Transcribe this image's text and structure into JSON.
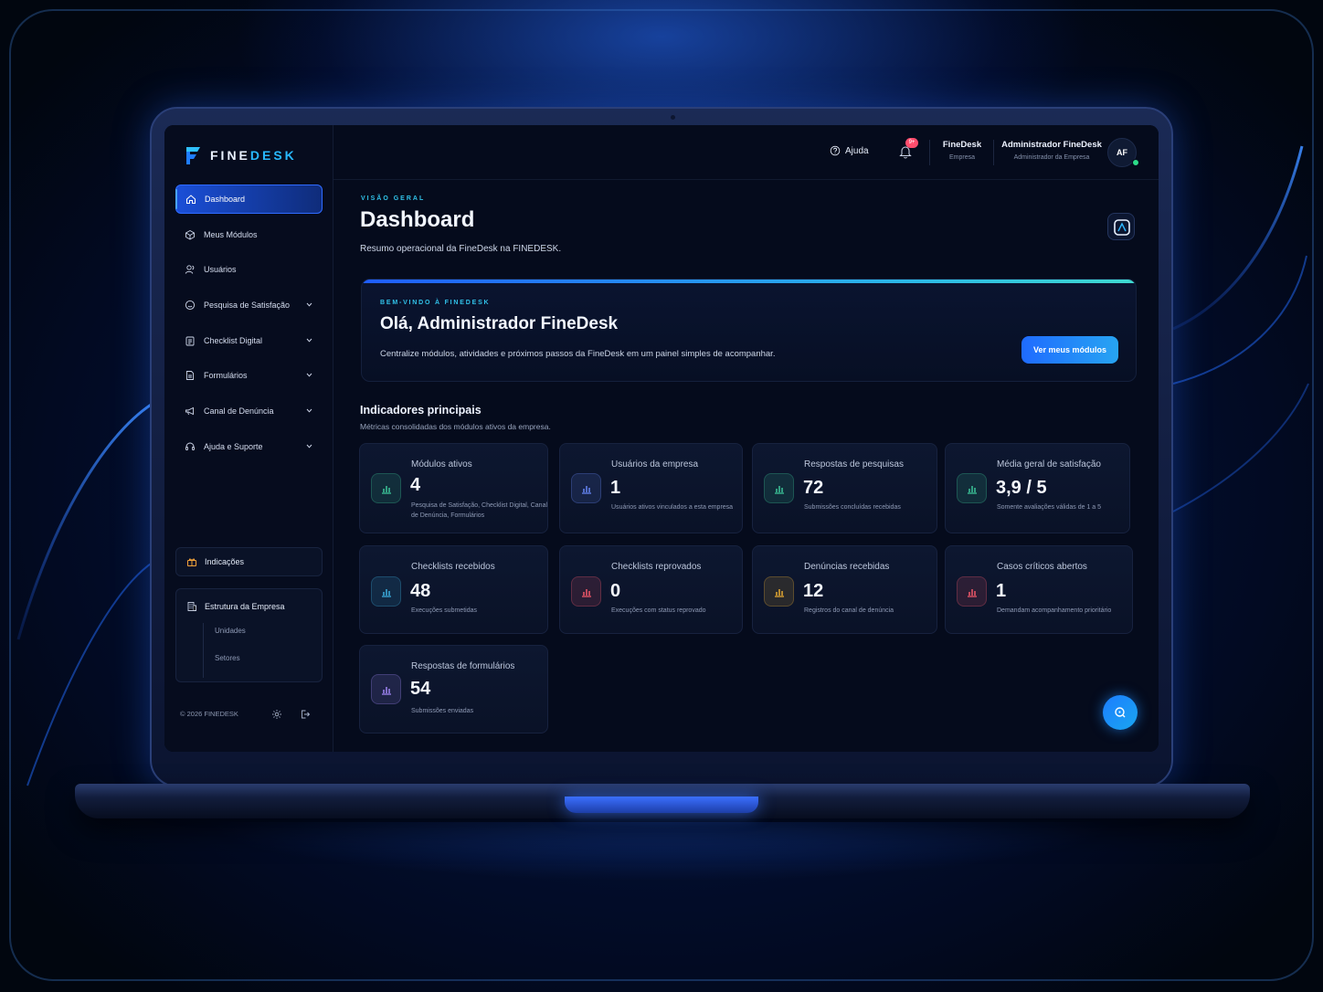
{
  "brand": {
    "name_a": "FINE",
    "name_b": "DESK",
    "color": "#28b9ff"
  },
  "sidebar": {
    "items": [
      {
        "label": "Dashboard",
        "icon": "home-icon",
        "active": true
      },
      {
        "label": "Meus Módulos",
        "icon": "cube-icon"
      },
      {
        "label": "Usuários",
        "icon": "user-icon"
      },
      {
        "label": "Pesquisa de Satisfação",
        "icon": "smile-icon",
        "expandable": true
      },
      {
        "label": "Checklist Digital",
        "icon": "clipboard-icon",
        "expandable": true
      },
      {
        "label": "Formulários",
        "icon": "document-icon",
        "expandable": true
      },
      {
        "label": "Canal de Denúncia",
        "icon": "megaphone-icon",
        "expandable": true
      },
      {
        "label": "Ajuda e Suporte",
        "icon": "headset-icon",
        "expandable": true
      }
    ],
    "indicacoes": "Indicações",
    "estrutura": {
      "title": "Estrutura da Empresa",
      "children": [
        "Unidades",
        "Setores"
      ]
    },
    "footer": "© 2026 FINEDESK"
  },
  "topbar": {
    "help": "Ajuda",
    "notif_badge": "9+",
    "company": {
      "name": "FineDesk",
      "role": "Empresa"
    },
    "user": {
      "name": "Administrador FineDesk",
      "role": "Administrador da Empresa",
      "initials": "AF"
    }
  },
  "page": {
    "eyebrow": "VISÃO GERAL",
    "title": "Dashboard",
    "subtitle": "Resumo operacional da FineDesk na FINEDESK."
  },
  "welcome": {
    "eyebrow": "BEM-VINDO À FINEDESK",
    "title": "Olá, Administrador FineDesk",
    "text": "Centralize módulos, atividades e próximos passos da FineDesk em um painel simples de acompanhar.",
    "button": "Ver meus módulos"
  },
  "indicators": {
    "title": "Indicadores principais",
    "subtitle": "Métricas consolidadas dos módulos ativos da empresa.",
    "cards": [
      {
        "label": "Módulos ativos",
        "value": "4",
        "desc": "Pesquisa de Satisfação, Checklist Digital, Canal de Denúncia, Formulários",
        "color": "#3fd0a0"
      },
      {
        "label": "Usuários da empresa",
        "value": "1",
        "desc": "Usuários ativos vinculados a esta empresa",
        "color": "#6b8cff"
      },
      {
        "label": "Respostas de pesquisas",
        "value": "72",
        "desc": "Submissões concluídas recebidas",
        "color": "#3fd0a0"
      },
      {
        "label": "Média geral de satisfação",
        "value": "3,9 / 5",
        "desc": "Somente avaliações válidas de 1 a 5",
        "color": "#3fd0a0"
      },
      {
        "label": "Checklists recebidos",
        "value": "48",
        "desc": "Execuções submetidas",
        "color": "#3fb6e8"
      },
      {
        "label": "Checklists reprovados",
        "value": "0",
        "desc": "Execuções com status reprovado",
        "color": "#ff5c6e"
      },
      {
        "label": "Denúncias recebidas",
        "value": "12",
        "desc": "Registros do canal de denúncia",
        "color": "#f2b233"
      },
      {
        "label": "Casos críticos abertos",
        "value": "1",
        "desc": "Demandam acompanhamento prioritário",
        "color": "#ff5c6e"
      },
      {
        "label": "Respostas de formulários",
        "value": "54",
        "desc": "Submissões enviadas",
        "color": "#a88cff"
      }
    ]
  }
}
